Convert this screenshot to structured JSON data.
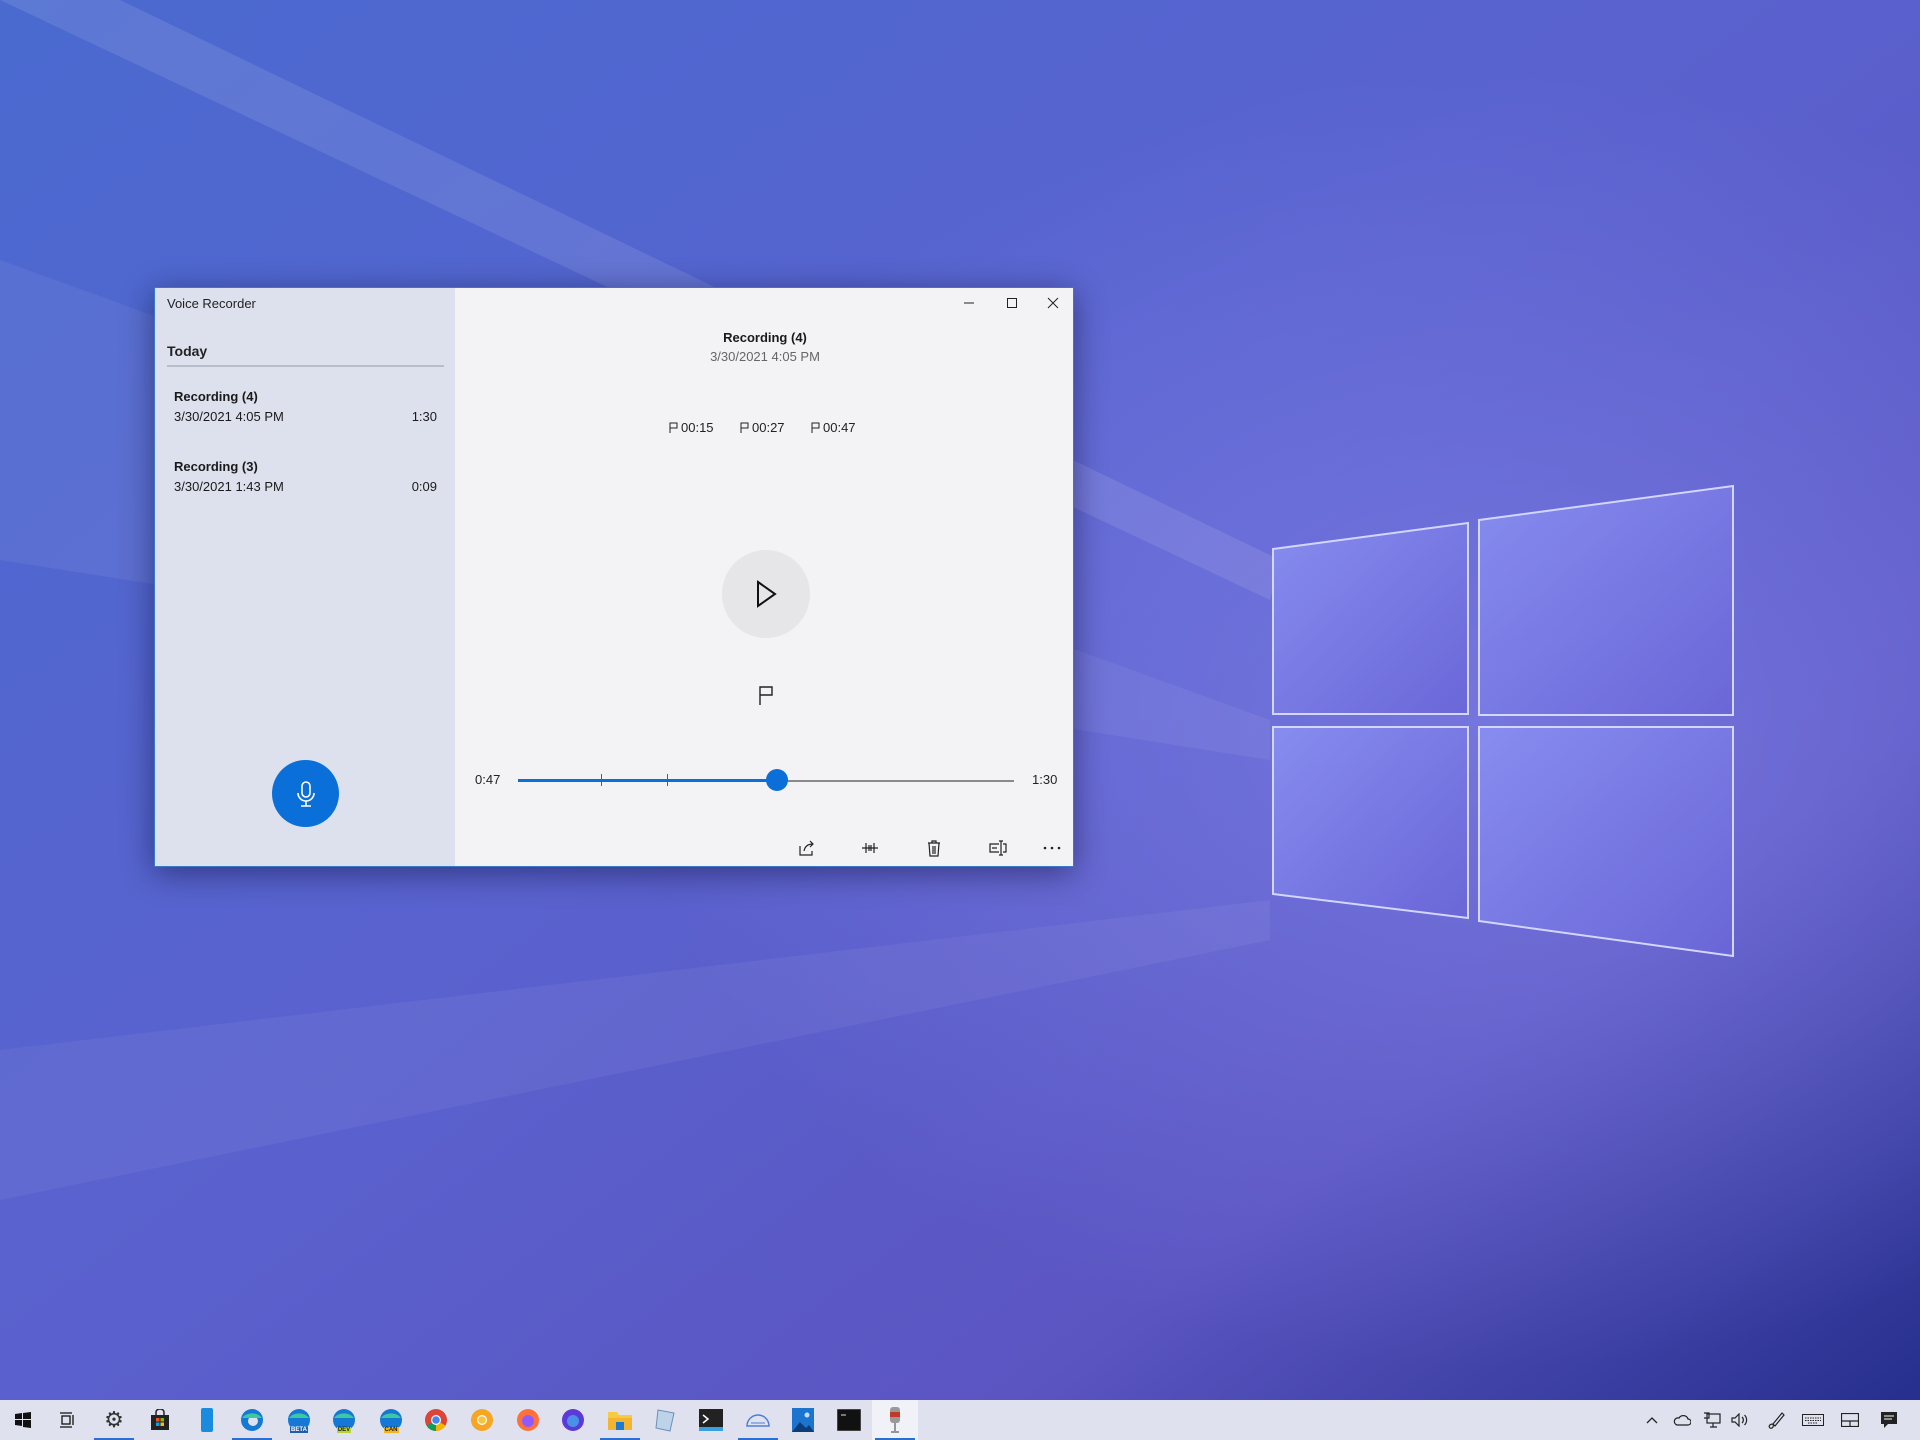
{
  "window": {
    "app_title": "Voice Recorder",
    "controls": {
      "minimize": "minimize",
      "maximize": "maximize",
      "close": "close"
    }
  },
  "sidebar": {
    "group_label": "Today",
    "recordings": [
      {
        "name": "Recording (4)",
        "date": "3/30/2021 4:05 PM",
        "duration": "1:30"
      },
      {
        "name": "Recording (3)",
        "date": "3/30/2021 1:43 PM",
        "duration": "0:09"
      }
    ],
    "record_button_icon": "microphone-icon"
  },
  "player": {
    "title": "Recording (4)",
    "date": "3/30/2021 4:05 PM",
    "markers": [
      "00:15",
      "00:27",
      "00:47"
    ],
    "current_time": "0:47",
    "total_time": "1:30",
    "progress_seconds": 47,
    "duration_seconds": 90,
    "marker_seconds": [
      15,
      27,
      47
    ],
    "toolbar": [
      "share-icon",
      "trim-icon",
      "delete-icon",
      "rename-icon",
      "more-icon"
    ]
  },
  "taskbar": {
    "apps": [
      "start",
      "task-view",
      "settings",
      "store",
      "phone",
      "edge",
      "edge-beta",
      "edge-dev",
      "edge-canary",
      "chrome",
      "chrome-canary",
      "firefox",
      "firefox-nightly",
      "file-explorer",
      "notepad",
      "terminal",
      "snip",
      "photos",
      "command-prompt",
      "voice-recorder"
    ],
    "badges": {
      "edge_beta": "BETA",
      "edge_dev": "DEV",
      "edge_canary": "CAN"
    },
    "tray": [
      "chevron-up",
      "onedrive",
      "network",
      "volume",
      "pen",
      "keyboard",
      "touchpad",
      "notifications"
    ]
  },
  "colors": {
    "accent": "#0a6fd8",
    "sidebar": "#dde1ee",
    "content": "#f3f2f5"
  }
}
